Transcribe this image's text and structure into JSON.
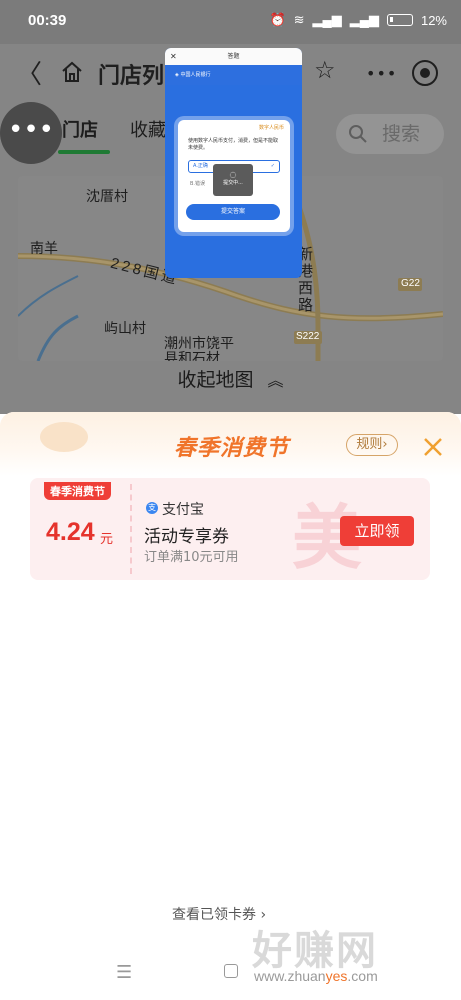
{
  "status_bar": {
    "time": "00:39",
    "battery": "12%"
  },
  "nav": {
    "back_icon": "back-arrow-icon",
    "home_icon": "home-icon",
    "title": "门店列",
    "star_icon": "star-icon",
    "more": "•••",
    "record_icon": "record-icon"
  },
  "tabs": {
    "active": "门店",
    "inactive": "收藏",
    "floating_more": "•••"
  },
  "search": {
    "placeholder": "搜索"
  },
  "map": {
    "labels": [
      "沈厝村",
      "南羊",
      "228国道",
      "屿山村",
      "潮州市饶平县和石材",
      "新港西路",
      "S222",
      "G22"
    ]
  },
  "collapse_map": {
    "label": "收起地图"
  },
  "popup": {
    "title": "答题",
    "bank": "中国人民银行",
    "corner": "数字人民币",
    "question": "使用数字人民币支付，消费，但是不能取未使费。",
    "option_a": "A.正确",
    "option_b": "B.错误",
    "loading": "提交中...",
    "submit": "提交答案"
  },
  "sheet": {
    "title": "春季消费节",
    "rules": "规则",
    "close_icon": "close-icon"
  },
  "coupon": {
    "tag": "春季消费节",
    "amount": "4.24",
    "unit": "元",
    "provider": "支付宝",
    "name": "活动专享券",
    "condition": "订单满10元可用",
    "claim": "立即领"
  },
  "footer": {
    "view_claimed": "查看已领卡券"
  },
  "watermark": {
    "main": "好赚网",
    "url_a": "www.zhuan",
    "url_b": "yes",
    "url_c": ".com"
  },
  "colors": {
    "accent_red": "#ef3e37",
    "title_orange": "#f0742a",
    "tab_green": "#2ea84a"
  }
}
